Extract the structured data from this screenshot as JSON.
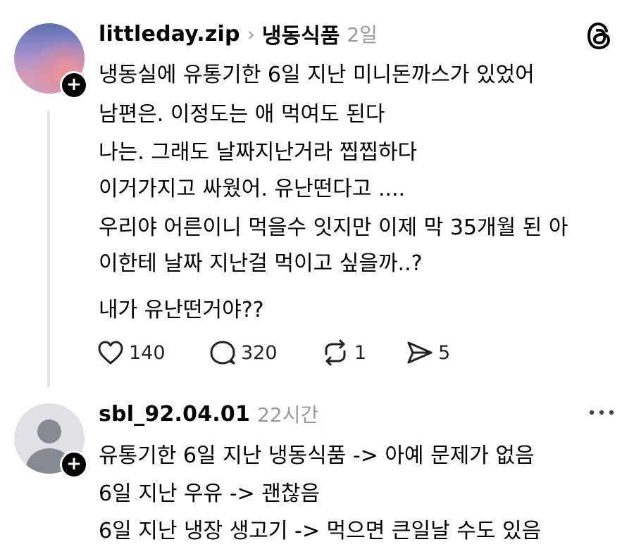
{
  "post": {
    "username": "littleday.zip",
    "chevron": "›",
    "topic": "냉동식품",
    "time": "2일",
    "lines": [
      "냉동실에 유통기한 6일 지난 미니돈까스가 있었어",
      "남편은. 이정도는 애 먹여도 된다",
      "나는. 그래도 날짜지난거라 찝찝하다",
      "이거가지고 싸웠어. 유난떤다고 ....",
      "우리야 어른이니 먹을수 잇지만  이제 막 35개월 된 아",
      "이한테 날짜 지난걸 먹이고 싶을까..?",
      "내가 유난떤거야??"
    ],
    "actions": {
      "like_count": "140",
      "comment_count": "320",
      "repost_count": "1",
      "share_count": "5"
    },
    "avatar_icon": "sunset-avatar",
    "badge_symbol": "+"
  },
  "reply": {
    "username": "sbl_92.04.01",
    "time": "22시간",
    "lines": [
      "유통기한 6일 지난 냉동식품 -> 아예 문제가 없음",
      "6일 지난 우유 -> 괜찮음",
      "6일 지난 냉장 생고기 -> 먹으면 큰일날 수도 있음"
    ],
    "avatar_icon": "default-avatar",
    "badge_symbol": "+",
    "more_icon": "more-icon"
  },
  "app_icon": "threads-logo-icon",
  "colors": {
    "text": "#000000",
    "secondary": "#999999",
    "thread_line": "#e6e6e6"
  }
}
